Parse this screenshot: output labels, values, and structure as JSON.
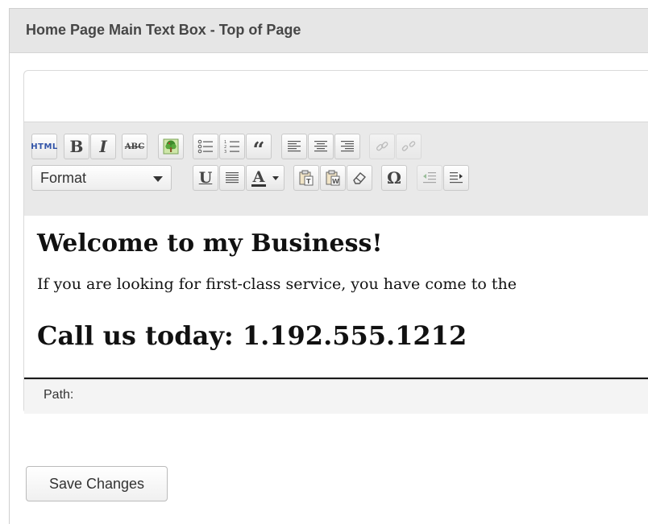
{
  "panel": {
    "title": "Home Page Main Text Box - Top of Page"
  },
  "toolbar": {
    "row1": [
      {
        "name": "html-button",
        "label": "HTML"
      },
      {
        "name": "bold-button",
        "label": "B"
      },
      {
        "name": "italic-button",
        "label": "I"
      },
      {
        "name": "strikethrough-button",
        "label": "ABC"
      },
      {
        "name": "insert-image-button",
        "icon": "tree-image-icon"
      },
      {
        "name": "bullet-list-button",
        "icon": "bullet-list-icon"
      },
      {
        "name": "numbered-list-button",
        "icon": "numbered-list-icon"
      },
      {
        "name": "blockquote-button",
        "label": "“"
      },
      {
        "name": "align-left-button",
        "icon": "align-left-icon"
      },
      {
        "name": "align-center-button",
        "icon": "align-center-icon"
      },
      {
        "name": "align-right-button",
        "icon": "align-right-icon"
      },
      {
        "name": "insert-link-button",
        "icon": "link-icon"
      },
      {
        "name": "unlink-button",
        "icon": "unlink-icon"
      }
    ],
    "row2": {
      "format_select": "Format",
      "buttons": [
        {
          "name": "underline-button",
          "label": "U"
        },
        {
          "name": "justify-button",
          "icon": "justify-icon"
        },
        {
          "name": "text-color-button",
          "label": "A"
        },
        {
          "name": "paste-text-button",
          "icon": "paste-text-icon"
        },
        {
          "name": "paste-word-button",
          "icon": "paste-word-icon"
        },
        {
          "name": "clear-formatting-button",
          "icon": "eraser-icon"
        },
        {
          "name": "special-character-button",
          "label": "Ω"
        },
        {
          "name": "outdent-button",
          "icon": "outdent-icon"
        },
        {
          "name": "indent-button",
          "icon": "indent-icon"
        }
      ]
    }
  },
  "content": {
    "heading": "Welcome to my Business!",
    "paragraph": "If you are looking for first-class service, you have come to the",
    "call": "Call us today: 1.192.555.1212"
  },
  "status": {
    "path_label": "Path:"
  },
  "actions": {
    "save_label": "Save Changes"
  },
  "colors": {
    "header_bg": "#e6e6e6",
    "toolbar_bg": "#e9e9e9",
    "html_blue": "#3254a8",
    "text_color_bar": "#333333"
  }
}
